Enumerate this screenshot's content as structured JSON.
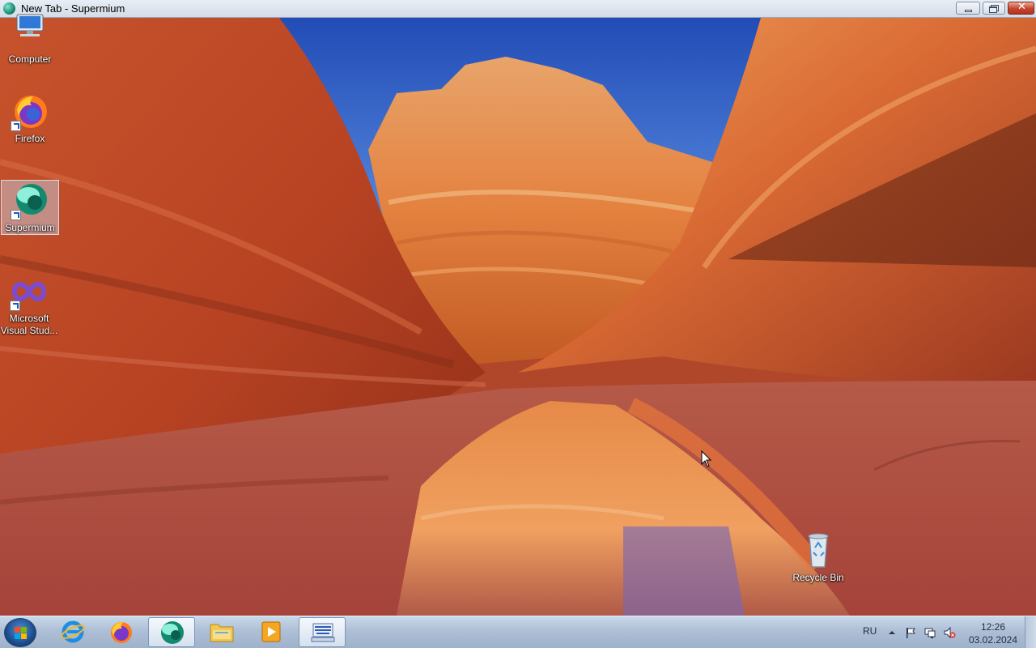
{
  "window": {
    "title": "New Tab - Supermium"
  },
  "desktop": {
    "icons": [
      {
        "label": "Computer",
        "icon": "computer-icon"
      },
      {
        "label": "Firefox",
        "icon": "firefox-icon"
      },
      {
        "label": "Supermium",
        "icon": "supermium-icon",
        "selected": true
      },
      {
        "label": "Microsoft Visual Stud...",
        "icon": "visual-studio-icon"
      },
      {
        "label": "Recycle Bin",
        "icon": "recycle-bin-icon"
      }
    ]
  },
  "taskbar": {
    "pinned": [
      {
        "name": "Internet Explorer",
        "icon": "internet-explorer-icon"
      },
      {
        "name": "Firefox",
        "icon": "firefox-icon"
      },
      {
        "name": "Supermium",
        "icon": "supermium-icon",
        "active": true
      },
      {
        "name": "Windows Explorer",
        "icon": "folder-icon"
      },
      {
        "name": "Windows Media Player",
        "icon": "media-player-icon"
      },
      {
        "name": "On-Screen Keyboard",
        "icon": "keyboard-icon"
      }
    ],
    "tray": {
      "language": "RU",
      "time": "12:26",
      "date": "03.02.2024",
      "icons": [
        "show-hidden-icons-icon",
        "action-center-flag-icon",
        "network-icon",
        "volume-muted-icon"
      ]
    }
  },
  "colors": {
    "taskbar": "#aebfd6",
    "close_button": "#c7432c",
    "sky": "#2c57b8",
    "rock": "#c85a30"
  }
}
